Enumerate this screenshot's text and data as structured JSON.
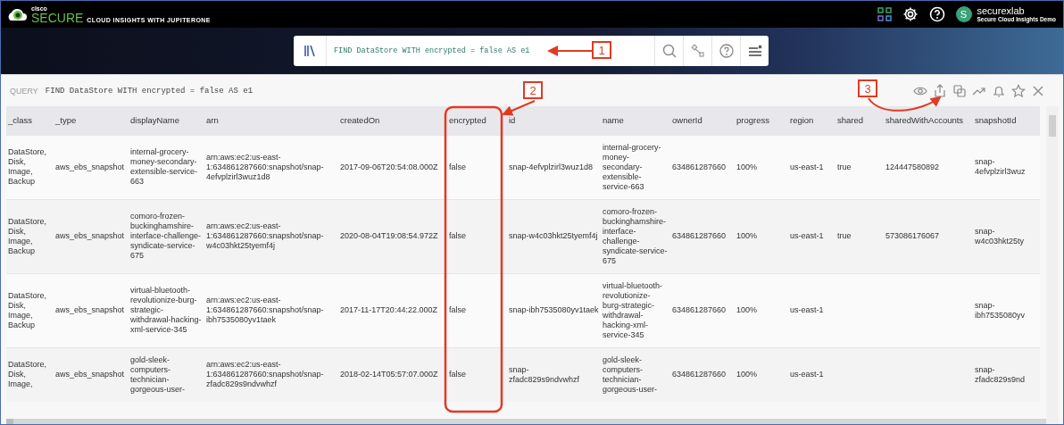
{
  "header": {
    "brand": "cisco",
    "product": "SECURE",
    "subtitle": "CLOUD INSIGHTS WITH JUPITERONE",
    "user": {
      "initial": "S",
      "name": "securexlab",
      "org": "Secure Cloud Insights Demo"
    }
  },
  "search": {
    "value": "FIND DataStore WITH encrypted = false AS e1"
  },
  "query_bar": {
    "label": "QUERY",
    "text": "FIND DataStore WITH encrypted = false AS e1"
  },
  "table": {
    "columns": [
      "_class",
      "_type",
      "displayName",
      "arn",
      "createdOn",
      "encrypted",
      "id",
      "name",
      "ownerId",
      "progress",
      "region",
      "shared",
      "sharedWithAccounts",
      "snapshotId"
    ],
    "rows": [
      [
        "DataStore, Disk, Image, Backup",
        "aws_ebs_snapshot",
        "internal-grocery-money-secondary-extensible-service-663",
        "arn:aws:ec2:us-east-1:634861287660:snapshot/snap-4efvplzirl3wuz1d8",
        "2017-09-06T20:54:08.000Z",
        "false",
        "snap-4efvplzirl3wuz1d8",
        "internal-grocery-money-secondary-extensible-service-663",
        "634861287660",
        "100%",
        "us-east-1",
        "true",
        "124447580892",
        "snap-4efvplzirl3wuz"
      ],
      [
        "DataStore, Disk, Image, Backup",
        "aws_ebs_snapshot",
        "comoro-frozen-buckinghamshire-interface-challenge-syndicate-service-675",
        "arn:aws:ec2:us-east-1:634861287660:snapshot/snap-w4c03hkt25tyemf4j",
        "2020-08-04T19:08:54.972Z",
        "false",
        "snap-w4c03hkt25tyemf4j",
        "comoro-frozen-buckinghamshire-interface-challenge-syndicate-service-675",
        "634861287660",
        "100%",
        "us-east-1",
        "true",
        "573086176067",
        "snap-w4c03hkt25ty"
      ],
      [
        "DataStore, Disk, Image, Backup",
        "aws_ebs_snapshot",
        "virtual-bluetooth-revolutionize-burg-strategic-withdrawal-hacking-xml-service-345",
        "arn:aws:ec2:us-east-1:634861287660:snapshot/snap-ibh7535080yv1taek",
        "2017-11-17T20:44:22.000Z",
        "false",
        "snap-ibh7535080yv1taek",
        "virtual-bluetooth-revolutionize-burg-strategic-withdrawal-hacking-xml-service-345",
        "634861287660",
        "100%",
        "us-east-1",
        "",
        "",
        "snap-ibh7535080yv"
      ],
      [
        "DataStore, Disk, Image,",
        "aws_ebs_snapshot",
        "gold-sleek-computers-technician-gorgeous-user-",
        "arn:aws:ec2:us-east-1:634861287660:snapshot/snap-zfadc829s9ndvwhzf",
        "2018-02-14T05:57:07.000Z",
        "false",
        "snap-zfadc829s9ndvwhzf",
        "gold-sleek-computers-technician-gorgeous-user-",
        "634861287660",
        "100%",
        "us-east-1",
        "",
        "",
        "snap-zfadc829s9nd"
      ]
    ]
  },
  "annotations": [
    {
      "kind": "callout",
      "label": "1"
    },
    {
      "kind": "callout",
      "label": "2"
    },
    {
      "kind": "callout",
      "label": "3"
    },
    {
      "kind": "highlight"
    }
  ]
}
